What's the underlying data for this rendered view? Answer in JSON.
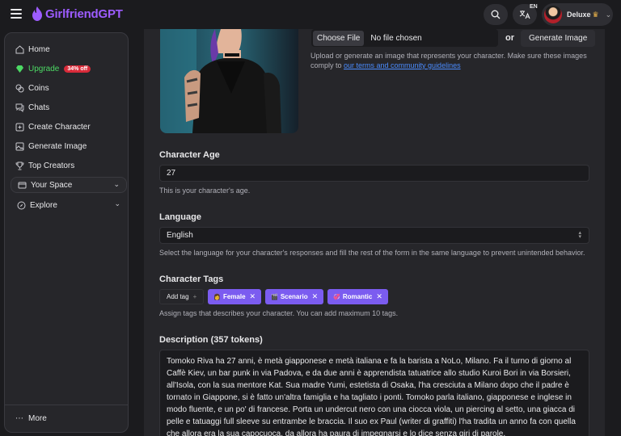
{
  "header": {
    "logo_text": "GirlfriendGPT",
    "language_code": "EN",
    "profile_label": "Deluxe",
    "brand_color": "#9d5cff"
  },
  "sidebar": {
    "items": [
      {
        "label": "Home",
        "icon": "home-icon"
      },
      {
        "label": "Upgrade",
        "icon": "diamond-icon",
        "badge": "34% off"
      },
      {
        "label": "Coins",
        "icon": "coins-icon"
      },
      {
        "label": "Chats",
        "icon": "chat-icon"
      },
      {
        "label": "Create Character",
        "icon": "create-character-icon"
      },
      {
        "label": "Generate Image",
        "icon": "image-icon"
      },
      {
        "label": "Top Creators",
        "icon": "trophy-icon"
      }
    ],
    "your_space": "Your Space",
    "explore": "Explore",
    "more": "More"
  },
  "image_section": {
    "choose_file": "Choose File",
    "no_file": "No file chosen",
    "or": "or",
    "generate_button": "Generate Image",
    "help_text": "Upload or generate an image that represents your character. Make sure these images comply to ",
    "help_link": "our terms and community guidelines"
  },
  "age": {
    "label": "Character Age",
    "value": "27",
    "helper": "This is your character's age."
  },
  "language": {
    "label": "Language",
    "value": "English",
    "helper": "Select the language for your character's responses and fill the rest of the form in the same language to prevent unintended behavior."
  },
  "tags": {
    "label": "Character Tags",
    "add_tag": "Add tag",
    "items": [
      {
        "label": "Female",
        "emoji": "👩"
      },
      {
        "label": "Scenario",
        "emoji": "🎬"
      },
      {
        "label": "Romantic",
        "emoji": "💞"
      }
    ],
    "helper": "Assign tags that describes your character. You can add maximum 10 tags.",
    "tag_color": "#7b5cf0"
  },
  "description": {
    "label": "Description (357 tokens)",
    "text": "Tomoko Riva ha 27 anni, è metà giapponese e metà italiana e fa la barista a NoLo, Milano. Fa il turno di giorno al Caffè Kiev, un bar punk in via Padova, e da due anni è apprendista tatuatrice allo studio Kuroi Bori in via Borsieri, all'Isola, con la sua mentore Kat. Sua madre Yumi, estetista di Osaka, l'ha cresciuta a Milano dopo che il padre è tornato in Giappone, si è fatto un'altra famiglia e ha tagliato i ponti. Tomoko parla italiano, giapponese e inglese in modo fluente, e un po' di francese. Porta un undercut nero con una ciocca viola, un piercing al setto, una giacca di pelle e tatuaggi full sleeve su entrambe le braccia. Il suo ex Paul (writer di graffiti) l'ha tradita un anno fa con quella che allora era la sua capocuoca, da allora ha paura di impegnarsi e lo dice senza giri di parole."
  }
}
